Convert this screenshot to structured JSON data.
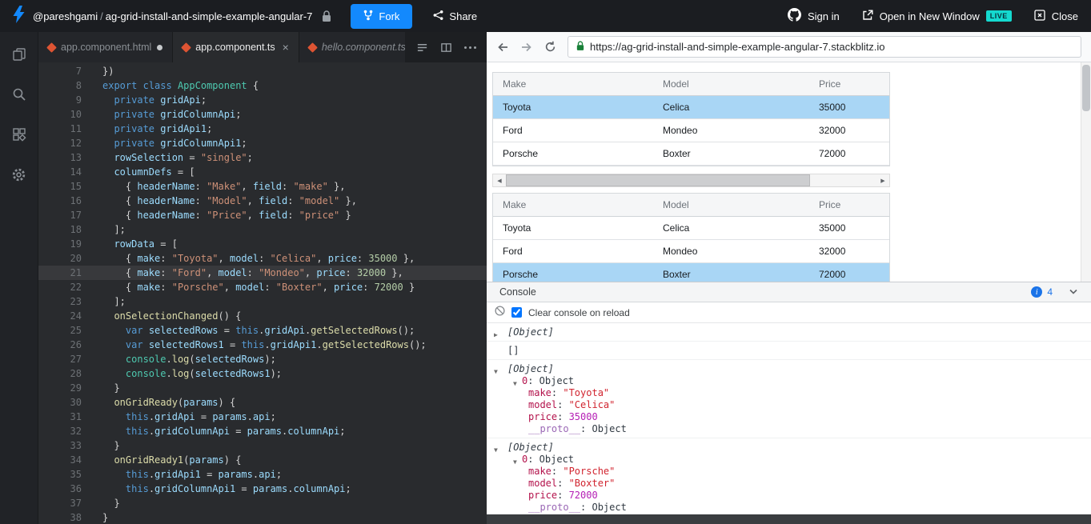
{
  "topbar": {
    "username": "@pareshgami",
    "separator": "/",
    "project_name": "ag-grid-install-and-simple-example-angular-7",
    "fork_label": "Fork",
    "share_label": "Share",
    "signin_label": "Sign in",
    "open_window_label": "Open in New Window",
    "live_label": "LIVE",
    "close_label": "Close"
  },
  "colors": {
    "accent_blue": "#1389fd",
    "live_teal": "#14d9cf",
    "selected_row_blue": "#a9d6f5",
    "console_badge_blue": "#1a73e8"
  },
  "editor": {
    "tabs": [
      {
        "label": "app.component.html",
        "active": false,
        "modified": true,
        "italic": false
      },
      {
        "label": "app.component.ts",
        "active": true,
        "close": "×",
        "italic": false
      },
      {
        "label": "hello.component.ts",
        "active": false,
        "italic": true
      }
    ],
    "lines": [
      {
        "n": 7,
        "t": [
          [
            "p",
            "})"
          ]
        ]
      },
      {
        "n": 8,
        "t": [
          [
            "k",
            "export"
          ],
          [
            "p",
            " "
          ],
          [
            "k",
            "class"
          ],
          [
            "p",
            " "
          ],
          [
            "t",
            "AppComponent"
          ],
          [
            "p",
            " {"
          ]
        ]
      },
      {
        "n": 9,
        "t": [
          [
            "p",
            "  "
          ],
          [
            "k",
            "private"
          ],
          [
            "p",
            " "
          ],
          [
            "v",
            "gridApi"
          ],
          [
            "p",
            ";"
          ]
        ]
      },
      {
        "n": 10,
        "t": [
          [
            "p",
            "  "
          ],
          [
            "k",
            "private"
          ],
          [
            "p",
            " "
          ],
          [
            "v",
            "gridColumnApi"
          ],
          [
            "p",
            ";"
          ]
        ]
      },
      {
        "n": 11,
        "t": [
          [
            "p",
            "  "
          ],
          [
            "k",
            "private"
          ],
          [
            "p",
            " "
          ],
          [
            "v",
            "gridApi1"
          ],
          [
            "p",
            ";"
          ]
        ]
      },
      {
        "n": 12,
        "t": [
          [
            "p",
            "  "
          ],
          [
            "k",
            "private"
          ],
          [
            "p",
            " "
          ],
          [
            "v",
            "gridColumnApi1"
          ],
          [
            "p",
            ";"
          ]
        ]
      },
      {
        "n": 13,
        "t": [
          [
            "p",
            "  "
          ],
          [
            "v",
            "rowSelection"
          ],
          [
            "p",
            " = "
          ],
          [
            "s",
            "\"single\""
          ],
          [
            "p",
            ";"
          ]
        ]
      },
      {
        "n": 14,
        "t": [
          [
            "p",
            "  "
          ],
          [
            "v",
            "columnDefs"
          ],
          [
            "p",
            " = ["
          ]
        ]
      },
      {
        "n": 15,
        "t": [
          [
            "p",
            "    { "
          ],
          [
            "v",
            "headerName"
          ],
          [
            "p",
            ": "
          ],
          [
            "s",
            "\"Make\""
          ],
          [
            "p",
            ", "
          ],
          [
            "v",
            "field"
          ],
          [
            "p",
            ": "
          ],
          [
            "s",
            "\"make\""
          ],
          [
            "p",
            " },"
          ]
        ]
      },
      {
        "n": 16,
        "t": [
          [
            "p",
            "    { "
          ],
          [
            "v",
            "headerName"
          ],
          [
            "p",
            ": "
          ],
          [
            "s",
            "\"Model\""
          ],
          [
            "p",
            ", "
          ],
          [
            "v",
            "field"
          ],
          [
            "p",
            ": "
          ],
          [
            "s",
            "\"model\""
          ],
          [
            "p",
            " },"
          ]
        ]
      },
      {
        "n": 17,
        "t": [
          [
            "p",
            "    { "
          ],
          [
            "v",
            "headerName"
          ],
          [
            "p",
            ": "
          ],
          [
            "s",
            "\"Price\""
          ],
          [
            "p",
            ", "
          ],
          [
            "v",
            "field"
          ],
          [
            "p",
            ": "
          ],
          [
            "s",
            "\"price\""
          ],
          [
            "p",
            " }"
          ]
        ]
      },
      {
        "n": 18,
        "t": [
          [
            "p",
            "  ];"
          ]
        ]
      },
      {
        "n": 19,
        "t": [
          [
            "p",
            "  "
          ],
          [
            "v",
            "rowData"
          ],
          [
            "p",
            " = ["
          ]
        ]
      },
      {
        "n": 20,
        "t": [
          [
            "p",
            "    { "
          ],
          [
            "v",
            "make"
          ],
          [
            "p",
            ": "
          ],
          [
            "s",
            "\"Toyota\""
          ],
          [
            "p",
            ", "
          ],
          [
            "v",
            "model"
          ],
          [
            "p",
            ": "
          ],
          [
            "s",
            "\"Celica\""
          ],
          [
            "p",
            ", "
          ],
          [
            "v",
            "price"
          ],
          [
            "p",
            ": "
          ],
          [
            "n",
            "35000"
          ],
          [
            "p",
            " },"
          ]
        ]
      },
      {
        "n": 21,
        "hl": true,
        "t": [
          [
            "p",
            "    { "
          ],
          [
            "v",
            "make"
          ],
          [
            "p",
            ": "
          ],
          [
            "s",
            "\"Ford\""
          ],
          [
            "p",
            ", "
          ],
          [
            "v",
            "model"
          ],
          [
            "p",
            ": "
          ],
          [
            "s",
            "\"Mondeo\""
          ],
          [
            "p",
            ", "
          ],
          [
            "v",
            "price"
          ],
          [
            "p",
            ": "
          ],
          [
            "n",
            "32000"
          ],
          [
            "p",
            " },"
          ]
        ]
      },
      {
        "n": 22,
        "t": [
          [
            "p",
            "    { "
          ],
          [
            "v",
            "make"
          ],
          [
            "p",
            ": "
          ],
          [
            "s",
            "\"Porsche\""
          ],
          [
            "p",
            ", "
          ],
          [
            "v",
            "model"
          ],
          [
            "p",
            ": "
          ],
          [
            "s",
            "\"Boxter\""
          ],
          [
            "p",
            ", "
          ],
          [
            "v",
            "price"
          ],
          [
            "p",
            ": "
          ],
          [
            "n",
            "72000"
          ],
          [
            "p",
            " }"
          ]
        ]
      },
      {
        "n": 23,
        "t": [
          [
            "p",
            "  ];"
          ]
        ]
      },
      {
        "n": 24,
        "t": [
          [
            "p",
            "  "
          ],
          [
            "f",
            "onSelectionChanged"
          ],
          [
            "p",
            "() {"
          ]
        ]
      },
      {
        "n": 25,
        "t": [
          [
            "p",
            "    "
          ],
          [
            "k",
            "var"
          ],
          [
            "p",
            " "
          ],
          [
            "v",
            "selectedRows"
          ],
          [
            "p",
            " = "
          ],
          [
            "k",
            "this"
          ],
          [
            "p",
            "."
          ],
          [
            "v",
            "gridApi"
          ],
          [
            "p",
            "."
          ],
          [
            "f",
            "getSelectedRows"
          ],
          [
            "p",
            "();"
          ]
        ]
      },
      {
        "n": 26,
        "t": [
          [
            "p",
            "    "
          ],
          [
            "k",
            "var"
          ],
          [
            "p",
            " "
          ],
          [
            "v",
            "selectedRows1"
          ],
          [
            "p",
            " = "
          ],
          [
            "k",
            "this"
          ],
          [
            "p",
            "."
          ],
          [
            "v",
            "gridApi1"
          ],
          [
            "p",
            "."
          ],
          [
            "f",
            "getSelectedRows"
          ],
          [
            "p",
            "();"
          ]
        ]
      },
      {
        "n": 27,
        "t": [
          [
            "p",
            "    "
          ],
          [
            "t",
            "console"
          ],
          [
            "p",
            "."
          ],
          [
            "f",
            "log"
          ],
          [
            "p",
            "("
          ],
          [
            "v",
            "selectedRows"
          ],
          [
            "p",
            ");"
          ]
        ]
      },
      {
        "n": 28,
        "t": [
          [
            "p",
            "    "
          ],
          [
            "t",
            "console"
          ],
          [
            "p",
            "."
          ],
          [
            "f",
            "log"
          ],
          [
            "p",
            "("
          ],
          [
            "v",
            "selectedRows1"
          ],
          [
            "p",
            ");"
          ]
        ]
      },
      {
        "n": 29,
        "t": [
          [
            "p",
            "  }"
          ]
        ]
      },
      {
        "n": 30,
        "t": [
          [
            "p",
            "  "
          ],
          [
            "f",
            "onGridReady"
          ],
          [
            "p",
            "("
          ],
          [
            "v",
            "params"
          ],
          [
            "p",
            ") {"
          ]
        ]
      },
      {
        "n": 31,
        "t": [
          [
            "p",
            "    "
          ],
          [
            "k",
            "this"
          ],
          [
            "p",
            "."
          ],
          [
            "v",
            "gridApi"
          ],
          [
            "p",
            " = "
          ],
          [
            "v",
            "params"
          ],
          [
            "p",
            "."
          ],
          [
            "v",
            "api"
          ],
          [
            "p",
            ";"
          ]
        ]
      },
      {
        "n": 32,
        "t": [
          [
            "p",
            "    "
          ],
          [
            "k",
            "this"
          ],
          [
            "p",
            "."
          ],
          [
            "v",
            "gridColumnApi"
          ],
          [
            "p",
            " = "
          ],
          [
            "v",
            "params"
          ],
          [
            "p",
            "."
          ],
          [
            "v",
            "columnApi"
          ],
          [
            "p",
            ";"
          ]
        ]
      },
      {
        "n": 33,
        "t": [
          [
            "p",
            "  }"
          ]
        ]
      },
      {
        "n": 34,
        "t": [
          [
            "p",
            "  "
          ],
          [
            "f",
            "onGridReady1"
          ],
          [
            "p",
            "("
          ],
          [
            "v",
            "params"
          ],
          [
            "p",
            ") {"
          ]
        ]
      },
      {
        "n": 35,
        "t": [
          [
            "p",
            "    "
          ],
          [
            "k",
            "this"
          ],
          [
            "p",
            "."
          ],
          [
            "v",
            "gridApi1"
          ],
          [
            "p",
            " = "
          ],
          [
            "v",
            "params"
          ],
          [
            "p",
            "."
          ],
          [
            "v",
            "api"
          ],
          [
            "p",
            ";"
          ]
        ]
      },
      {
        "n": 36,
        "t": [
          [
            "p",
            "    "
          ],
          [
            "k",
            "this"
          ],
          [
            "p",
            "."
          ],
          [
            "v",
            "gridColumnApi1"
          ],
          [
            "p",
            " = "
          ],
          [
            "v",
            "params"
          ],
          [
            "p",
            "."
          ],
          [
            "v",
            "columnApi"
          ],
          [
            "p",
            ";"
          ]
        ]
      },
      {
        "n": 37,
        "t": [
          [
            "p",
            "  }"
          ]
        ]
      },
      {
        "n": 38,
        "t": [
          [
            "p",
            "}"
          ]
        ]
      }
    ]
  },
  "browser": {
    "url": "https://ag-grid-install-and-simple-example-angular-7.stackblitz.io"
  },
  "preview": {
    "grids": [
      {
        "headers": [
          "Make",
          "Model",
          "Price"
        ],
        "rows": [
          [
            "Toyota",
            "Celica",
            "35000"
          ],
          [
            "Ford",
            "Mondeo",
            "32000"
          ],
          [
            "Porsche",
            "Boxter",
            "72000"
          ]
        ],
        "selected_row": 0
      },
      {
        "headers": [
          "Make",
          "Model",
          "Price"
        ],
        "rows": [
          [
            "Toyota",
            "Celica",
            "35000"
          ],
          [
            "Ford",
            "Mondeo",
            "32000"
          ],
          [
            "Porsche",
            "Boxter",
            "72000"
          ]
        ],
        "selected_row": 2
      }
    ]
  },
  "console": {
    "title": "Console",
    "badge_count": "4",
    "clear_label": "Clear console on reload",
    "entries": [
      {
        "kind": "collapsed",
        "label": "[Object]"
      },
      {
        "kind": "array",
        "label": "[]"
      },
      {
        "kind": "object",
        "label": "[Object]",
        "item_key": "0",
        "item_type": "Object",
        "props": [
          {
            "k": "make",
            "v": "\"Toyota\"",
            "vt": "str"
          },
          {
            "k": "model",
            "v": "\"Celica\"",
            "vt": "str"
          },
          {
            "k": "price",
            "v": "35000",
            "vt": "num"
          },
          {
            "k": "__proto__",
            "v": "Object",
            "vt": "proto"
          }
        ]
      },
      {
        "kind": "object",
        "label": "[Object]",
        "item_key": "0",
        "item_type": "Object",
        "props": [
          {
            "k": "make",
            "v": "\"Porsche\"",
            "vt": "str"
          },
          {
            "k": "model",
            "v": "\"Boxter\"",
            "vt": "str"
          },
          {
            "k": "price",
            "v": "72000",
            "vt": "num"
          },
          {
            "k": "__proto__",
            "v": "Object",
            "vt": "proto"
          }
        ]
      }
    ]
  }
}
